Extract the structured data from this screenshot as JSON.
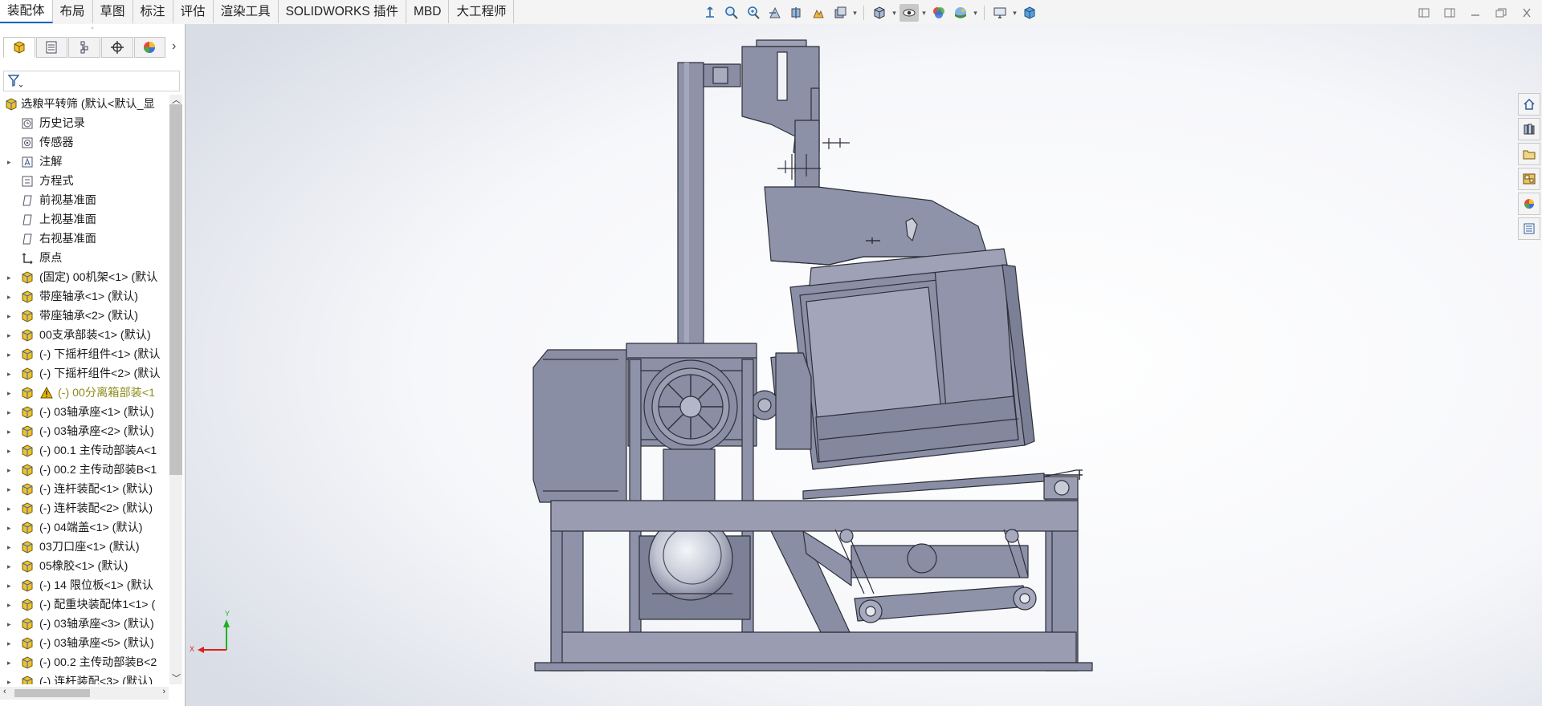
{
  "tabs": [
    "装配体",
    "布局",
    "草图",
    "标注",
    "评估",
    "渲染工具",
    "SOLIDWORKS 插件",
    "MBD",
    "大工程师"
  ],
  "active_tab": 0,
  "view_tools": [
    "view-orientation-icon",
    "zoom-to-fit-icon",
    "zoom-to-area-icon",
    "previous-view-icon",
    "section-view-icon",
    "dynamic-annotation-icon",
    "view-orientation-dropdown-icon",
    "display-style-icon",
    "hide-show-items-icon",
    "edit-appearance-icon",
    "apply-scene-icon",
    "view-settings-icon",
    "view-cube-icon"
  ],
  "feature_tree": {
    "root": "选粮平转筛 (默认<默认_显",
    "items": [
      {
        "label": "历史记录",
        "icon": "history-icon",
        "expandable": false
      },
      {
        "label": "传感器",
        "icon": "sensor-icon",
        "expandable": false
      },
      {
        "label": "注解",
        "icon": "annotation-icon",
        "expandable": true
      },
      {
        "label": "方程式",
        "icon": "equation-icon",
        "expandable": false
      },
      {
        "label": "前视基准面",
        "icon": "plane-icon",
        "expandable": false
      },
      {
        "label": "上视基准面",
        "icon": "plane-icon",
        "expandable": false
      },
      {
        "label": "右视基准面",
        "icon": "plane-icon",
        "expandable": false
      },
      {
        "label": "原点",
        "icon": "origin-icon",
        "expandable": false
      },
      {
        "label": "(固定) 00机架<1> (默认",
        "icon": "component-icon",
        "expandable": true
      },
      {
        "label": "带座轴承<1> (默认)",
        "icon": "component-icon",
        "expandable": true
      },
      {
        "label": "带座轴承<2> (默认)",
        "icon": "component-icon",
        "expandable": true
      },
      {
        "label": "00支承部装<1> (默认)",
        "icon": "component-icon",
        "expandable": true
      },
      {
        "label": "(-) 下摇杆组件<1> (默认",
        "icon": "component-icon",
        "expandable": true
      },
      {
        "label": "(-) 下摇杆组件<2> (默认",
        "icon": "component-icon",
        "expandable": true
      },
      {
        "label": "(-) 00分离箱部装<1",
        "icon": "warning-icon",
        "expandable": true,
        "warning": true
      },
      {
        "label": "(-) 03轴承座<1> (默认)",
        "icon": "component-icon",
        "expandable": true
      },
      {
        "label": "(-) 03轴承座<2> (默认)",
        "icon": "component-icon",
        "expandable": true
      },
      {
        "label": "(-) 00.1 主传动部装A<1",
        "icon": "component-icon",
        "expandable": true
      },
      {
        "label": "(-) 00.2 主传动部装B<1",
        "icon": "component-icon",
        "expandable": true
      },
      {
        "label": "(-) 连杆装配<1> (默认)",
        "icon": "component-icon",
        "expandable": true
      },
      {
        "label": "(-) 连杆装配<2> (默认)",
        "icon": "component-icon",
        "expandable": true
      },
      {
        "label": "(-) 04端盖<1> (默认)",
        "icon": "component-icon",
        "expandable": true
      },
      {
        "label": "03刀口座<1> (默认)",
        "icon": "component-icon",
        "expandable": true
      },
      {
        "label": "05橡胶<1> (默认)",
        "icon": "component-icon",
        "expandable": true
      },
      {
        "label": "(-) 14 限位板<1> (默认",
        "icon": "component-icon",
        "expandable": true
      },
      {
        "label": "(-) 配重块装配体1<1> (",
        "icon": "component-icon",
        "expandable": true
      },
      {
        "label": "(-) 03轴承座<3> (默认)",
        "icon": "component-icon",
        "expandable": true
      },
      {
        "label": "(-) 03轴承座<5> (默认)",
        "icon": "component-icon",
        "expandable": true
      },
      {
        "label": "(-) 00.2 主传动部装B<2",
        "icon": "component-icon",
        "expandable": true
      },
      {
        "label": "(-) 连杆装配<3> (默认)",
        "icon": "component-icon",
        "expandable": true
      }
    ]
  },
  "triad": {
    "x": "X",
    "y": "Y"
  },
  "task_pane": [
    "home-icon",
    "design-library-icon",
    "file-explorer-icon",
    "view-palette-icon",
    "appearances-icon",
    "custom-properties-icon"
  ],
  "colors": {
    "accent": "#0a64c8",
    "model_fill": "#8d90a6",
    "model_light": "#a9acbf",
    "model_dark": "#6e7188",
    "axis_x": "#e0201a",
    "axis_y": "#20b020",
    "warning": "#e8b400"
  }
}
